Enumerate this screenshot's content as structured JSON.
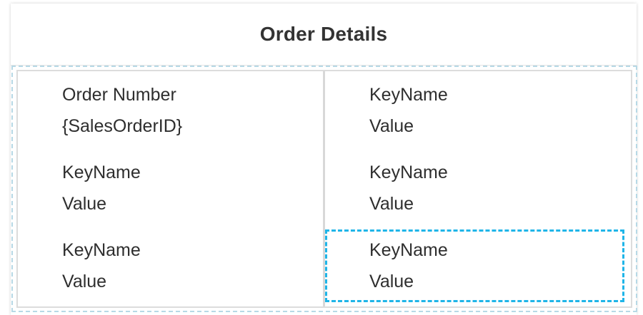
{
  "title": "Order Details",
  "fields": {
    "left": [
      {
        "key": "Order Number",
        "value": "{SalesOrderID}"
      },
      {
        "key": "KeyName",
        "value": "Value"
      },
      {
        "key": "KeyName",
        "value": "Value"
      }
    ],
    "right": [
      {
        "key": "KeyName",
        "value": "Value"
      },
      {
        "key": "KeyName",
        "value": "Value"
      },
      {
        "key": "KeyName",
        "value": "Value"
      }
    ]
  },
  "colors": {
    "selection_outline": "#1fb5e8",
    "container_dashed_border": "#b7d9e6",
    "text": "#2e2e2e",
    "title_text": "#333333"
  }
}
